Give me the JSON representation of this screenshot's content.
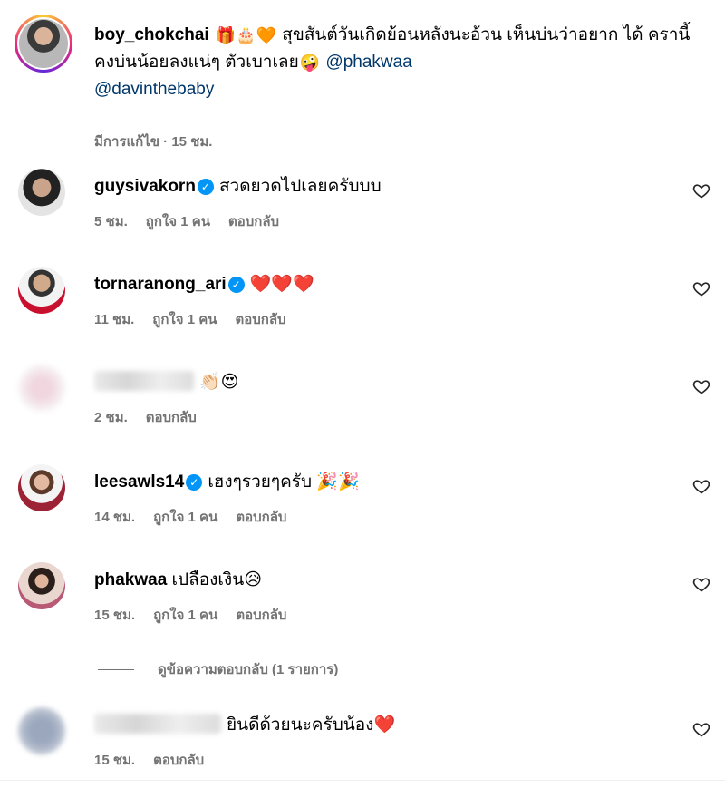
{
  "caption": {
    "username": "boy_chokchai",
    "text_part1": "สุขสันต์วันเกิดย้อนหลังนะอ้วน เห็นบ่นว่าอยาก ได้ ครานี้คงบ่นน้อยลงแน่ๆ ตัวเบาเลย",
    "mention1": "@phakwaa",
    "mention2": "@davinthebaby",
    "emoji_prefix": "🎁🎂🧡",
    "emoji_suffix": "🤪",
    "meta": "มีการแก้ไข · 15 ชม."
  },
  "comments": [
    {
      "username": "guysivakorn",
      "verified": true,
      "text": "สวดยวดไปเลยครับบบ",
      "time": "5 ชม.",
      "likes": "ถูกใจ 1 คน",
      "reply": "ตอบกลับ"
    },
    {
      "username": "tornaranong_ari",
      "verified": true,
      "text": "❤️❤️❤️",
      "time": "11 ชม.",
      "likes": "ถูกใจ 1 คน",
      "reply": "ตอบกลับ"
    },
    {
      "username": "",
      "verified": false,
      "text": "👏🏻😍",
      "time": "2 ชม.",
      "likes": "",
      "reply": "ตอบกลับ"
    },
    {
      "username": "leesawls14",
      "verified": true,
      "text": "เฮงๆรวยๆครับ 🎉🎉",
      "time": "14 ชม.",
      "likes": "ถูกใจ 1 คน",
      "reply": "ตอบกลับ"
    },
    {
      "username": "phakwaa",
      "verified": false,
      "text": "เปลืองเงิน😥",
      "time": "15 ชม.",
      "likes": "ถูกใจ 1 คน",
      "reply": "ตอบกลับ"
    },
    {
      "username": "",
      "verified": false,
      "text": "ยินดีด้วยนะครับน้อง❤️",
      "time": "15 ชม.",
      "likes": "",
      "reply": "ตอบกลับ"
    }
  ],
  "view_replies": "ดูข้อความตอบกลับ (1 รายการ)",
  "icons": {
    "heart": "heart-outline-icon",
    "verified": "verified-badge-icon"
  },
  "colors": {
    "mention": "#00376b",
    "meta": "#737373",
    "verified": "#0095f6"
  }
}
